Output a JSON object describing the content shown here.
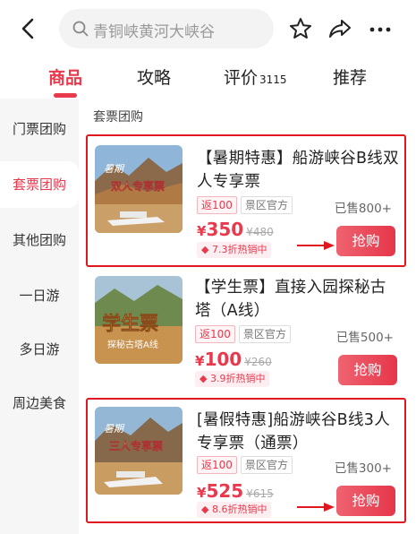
{
  "header": {
    "search_placeholder": "青铜峡黄河大峡谷"
  },
  "tabs": [
    {
      "label": "商品",
      "active": true
    },
    {
      "label": "攻略"
    },
    {
      "label": "评价",
      "count": "3115"
    },
    {
      "label": "推荐"
    }
  ],
  "sidebar": {
    "items": [
      {
        "label": "门票团购"
      },
      {
        "label": "套票团购",
        "active": true
      },
      {
        "label": "其他团购"
      },
      {
        "label": "一日游"
      },
      {
        "label": "多日游"
      },
      {
        "label": "周边美食"
      }
    ]
  },
  "section_title": "套票团购",
  "products": [
    {
      "title": "【暑期特惠】船游峡谷B线双人专享票",
      "tags": [
        "返100",
        "景区官方"
      ],
      "sold": "已售800+",
      "price_symbol": "¥",
      "price": "350",
      "original_price": "¥480",
      "discount": "7.3折热销中",
      "buy_label": "抢购",
      "thumb_text": "双人专享票",
      "thumb_sub": "暑期",
      "highlighted": true
    },
    {
      "title": "【学生票】直接入园探秘古塔（A线）",
      "tags": [
        "返100",
        "景区官方"
      ],
      "sold": "已售500+",
      "price_symbol": "¥",
      "price": "100",
      "original_price": "¥260",
      "discount": "3.9折热销中",
      "buy_label": "抢购",
      "thumb_text": "学生票",
      "thumb_sub": "探秘古塔A线",
      "highlighted": false
    },
    {
      "title": "[暑假特惠]船游峡谷B线3人专享票（通票）",
      "tags": [
        "返100",
        "景区官方"
      ],
      "sold": "已售300+",
      "price_symbol": "¥",
      "price": "525",
      "original_price": "¥615",
      "discount": "8.6折热销中",
      "buy_label": "抢购",
      "thumb_text": "三人专享票",
      "thumb_sub": "暑期",
      "highlighted": true
    }
  ],
  "colors": {
    "accent": "#e8394d",
    "highlight_border": "#e0171e"
  },
  "icons": [
    "back-arrow-icon",
    "search-icon",
    "star-icon",
    "share-icon",
    "more-icon",
    "fire-icon",
    "red-arrow-icon"
  ]
}
